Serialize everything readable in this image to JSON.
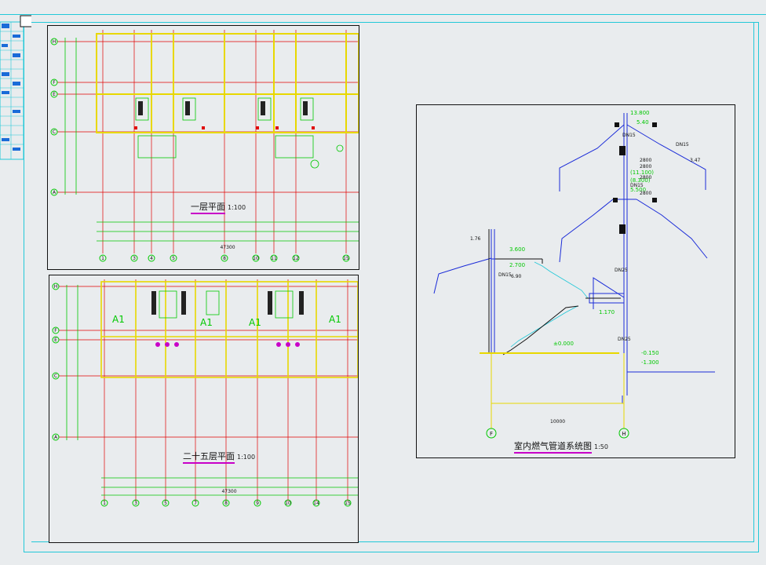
{
  "drawing": {
    "plan1": {
      "title": "一层平面",
      "scale": "1:100"
    },
    "plan2": {
      "title": "二十五层平面",
      "scale": "1:100"
    },
    "system": {
      "title": "室内燃气管道系统图",
      "scale": "1:50"
    }
  },
  "plan1_labels": {
    "axes_left": [
      "H",
      "F",
      "E",
      "C",
      "A"
    ],
    "axes_bottom": [
      "1",
      "3",
      "4",
      "5",
      "8",
      "10",
      "11",
      "12",
      "15"
    ],
    "total_dim": "47300"
  },
  "plan2_labels": {
    "axes_left": [
      "H",
      "F",
      "E",
      "C",
      "A"
    ],
    "axes_bottom": [
      "1",
      "3",
      "5",
      "7",
      "8",
      "9",
      "10",
      "14",
      "15"
    ],
    "unit_tags": [
      "A1",
      "A1",
      "A1",
      "A1"
    ],
    "total_dim": "47300"
  },
  "system_labels": {
    "elevations": [
      "13.800",
      "5.40",
      "(11.100)",
      "(8.300)",
      "5.500",
      "3.600",
      "2.700",
      "1.170",
      "±0.000",
      "-0.150",
      "-1.300",
      "3.47",
      "1.76",
      "6.90"
    ],
    "pipes": [
      "DN15",
      "DN15",
      "DN15",
      "DN25",
      "DN25",
      "DN15"
    ],
    "dims": [
      "2800",
      "2800",
      "2800",
      "2800",
      "10000"
    ],
    "axis_marks": [
      "F",
      "H"
    ]
  },
  "colors": {
    "frame": "#22c8d8",
    "wall_yellow": "#e8d800",
    "axis_red": "#e00000",
    "dim_green": "#00c800",
    "pipe_blue": "#1a2bd8",
    "cyan": "#22c8d8",
    "magenta": "#c800c8"
  }
}
